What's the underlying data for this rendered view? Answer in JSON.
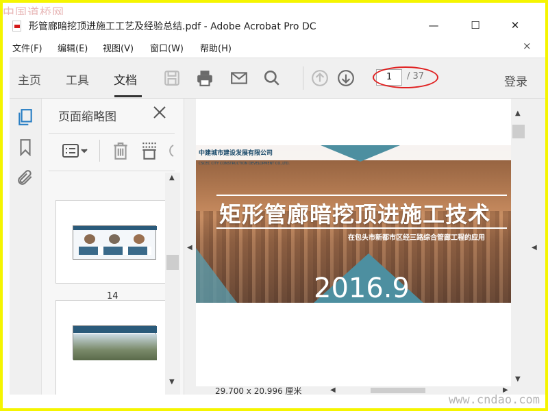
{
  "watermarks": {
    "top_left": "中国道桥网",
    "bottom_right": "www.cndao.com"
  },
  "window": {
    "title": "形管廊暗挖顶进施工工艺及经验总结.pdf - Adobe Acrobat Pro DC",
    "minimize": "—",
    "maximize": "☐",
    "close": "✕"
  },
  "menu": {
    "items": [
      "文件(F)",
      "编辑(E)",
      "视图(V)",
      "窗口(W)",
      "帮助(H)"
    ],
    "close_doc": "×"
  },
  "toolbar": {
    "tabs": [
      "主页",
      "工具",
      "文档"
    ],
    "active_tab": "文档",
    "page_current": "1",
    "page_total": "/ 37",
    "login": "登录",
    "icons": [
      "save-icon",
      "print-icon",
      "email-icon",
      "search-icon",
      "page-up-icon",
      "page-down-icon"
    ]
  },
  "left_rail": {
    "icons": [
      "page-thumbnails-icon",
      "bookmark-icon",
      "attachment-icon"
    ]
  },
  "thumbnail_panel": {
    "title": "页面缩略图",
    "close": "✕",
    "tools": [
      "thumbnail-options-icon",
      "delete-page-icon",
      "insert-page-icon",
      "rotate-page-icon"
    ],
    "pages": [
      {
        "number": "14"
      },
      {
        "number": ""
      }
    ]
  },
  "document": {
    "company_cn": "中建城市建设发展有限公司",
    "company_en": "CSCEC CITY CONSTRUCTION DEVELOPMENT CO.,LTD.",
    "title": "矩形管廊暗挖顶进施工技术",
    "subtitle": "在包头市新都市区经三路综合管廊工程的应用",
    "year": "2016.9"
  },
  "status": {
    "page_size": "29.700 x 20.996 厘米"
  },
  "colors": {
    "accent_red": "#e02020",
    "teal": "#4d8fa0",
    "toolbar_bg": "#f0f0f0"
  }
}
